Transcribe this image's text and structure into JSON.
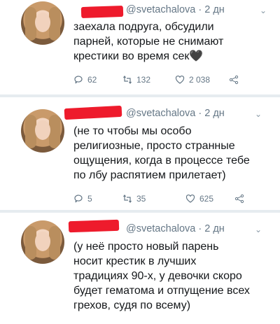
{
  "tweets": [
    {
      "handle": "@svetachalova",
      "time": "· 2 дн",
      "lines": [
        "заехала подруга, обсудили",
        "парней, которые не снимают",
        "крестики во время сек"
      ],
      "emoji": "🖤",
      "replies": "62",
      "retweets": "132",
      "likes": "2 038"
    },
    {
      "handle": "@svetachalova",
      "time": "· 2 дн",
      "lines": [
        "(не то чтобы мы особо",
        "религиозные, просто странные",
        "ощущения, когда в процессе тебе",
        "по лбу распятием прилетает)"
      ],
      "replies": "5",
      "retweets": "35",
      "likes": "625"
    },
    {
      "handle": "@svetachalova",
      "time": "· 2 дн",
      "lines": [
        "(у неё просто новый парень",
        "носит крестик в лучших",
        "традициях 90-х, у девочки скоро",
        "будет гематома и отпущение всех",
        "грехов, судя по всему)"
      ]
    }
  ],
  "colors": {
    "redaction": "#ee1b2c",
    "muted": "#657786",
    "divider": "#e6ecf0"
  },
  "icons": {
    "reply": "reply-icon",
    "retweet": "retweet-icon",
    "like": "heart-icon",
    "share": "share-icon",
    "menu": "chevron-down-icon"
  }
}
